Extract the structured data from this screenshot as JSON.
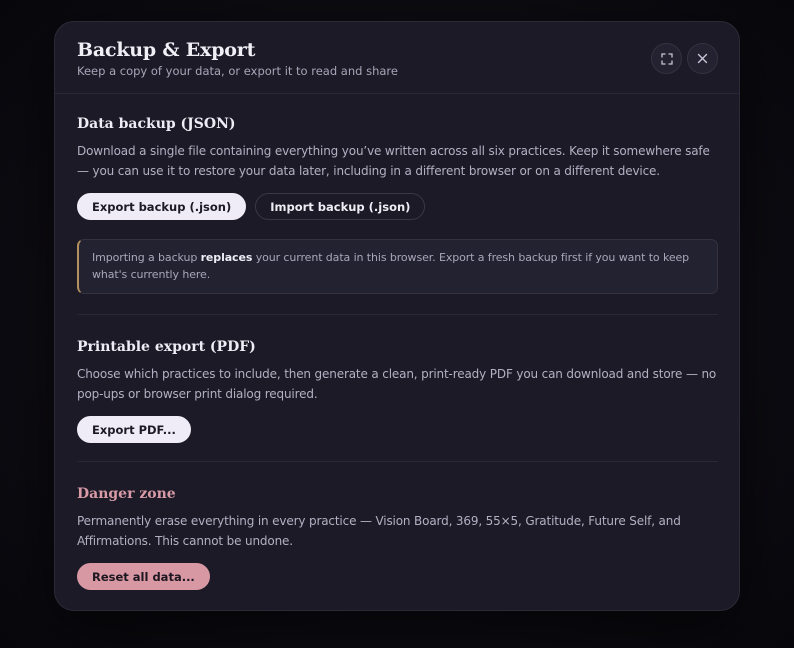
{
  "modal": {
    "title": "Backup & Export",
    "subtitle": "Keep a copy of your data, or export it to read and share",
    "expand_icon": "expand-icon",
    "close_icon": "close-icon"
  },
  "backup": {
    "title": "Data backup (JSON)",
    "description": "Download a single file containing everything you’ve written across all six practices. Keep it somewhere safe — you can use it to restore your data later, including in a different browser or on a different device.",
    "export_label": "Export backup (.json)",
    "import_label": "Import backup (.json)",
    "notice_prefix": "Importing a backup ",
    "notice_bold": "replaces",
    "notice_suffix": " your current data in this browser. Export a fresh backup first if you want to keep what's currently here."
  },
  "pdf": {
    "title": "Printable export (PDF)",
    "description": "Choose which practices to include, then generate a clean, print-ready PDF you can download and store — no pop-ups or browser print dialog required.",
    "export_label": "Export PDF..."
  },
  "danger": {
    "title": "Danger zone",
    "description": "Permanently erase everything in every practice — Vision Board, 369, 55×5, Gratitude, Future Self, and Affirmations. This cannot be undone.",
    "reset_label": "Reset all data..."
  },
  "colors": {
    "accent_light": "#f0ecf7",
    "danger": "#d898a3",
    "notice_border": "#b28f5c",
    "background": "#1b1a26"
  }
}
